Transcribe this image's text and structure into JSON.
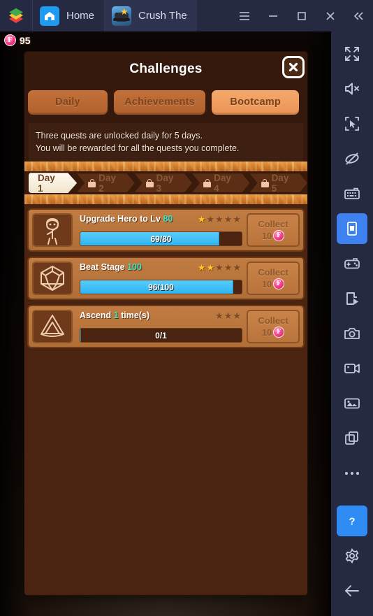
{
  "window": {
    "app_logo": "bluestacks-logo",
    "tabs": [
      {
        "label": "Home",
        "icon": "home-icon",
        "active": false
      },
      {
        "label": "Crush The",
        "icon": "game-app-icon",
        "active": true
      }
    ],
    "controls": [
      {
        "name": "menu-button",
        "icon": "hamburger-icon"
      },
      {
        "name": "minimize-button",
        "icon": "minimize-icon"
      },
      {
        "name": "maximize-button",
        "icon": "maximize-icon"
      },
      {
        "name": "close-button",
        "icon": "close-icon"
      },
      {
        "name": "collapse-sidebar-button",
        "icon": "chevron-double-left-icon"
      }
    ]
  },
  "game": {
    "currency": {
      "icon": "pink-gem-icon",
      "amount": "95"
    },
    "panel": {
      "title": "Challenges",
      "close_icon": "close-x-icon",
      "tabs": [
        {
          "label": "Daily",
          "active": false
        },
        {
          "label": "Achievements",
          "active": false
        },
        {
          "label": "Bootcamp",
          "active": true
        }
      ],
      "info_lines": [
        "Three quests are unlocked daily for 5 days.",
        "You will be rewarded for all the quests you complete."
      ],
      "days": [
        {
          "label": "Day 1",
          "locked": false
        },
        {
          "label": "Day 2",
          "locked": true
        },
        {
          "label": "Day 3",
          "locked": true
        },
        {
          "label": "Day 4",
          "locked": true
        },
        {
          "label": "Day 5",
          "locked": true
        }
      ],
      "quests": [
        {
          "icon": "hero-character-icon",
          "title_prefix": "Upgrade Hero to Lv ",
          "title_value": "80",
          "title_suffix": "",
          "stars_total": 5,
          "stars_filled": 1,
          "progress_text": "69/80",
          "progress_current": 69,
          "progress_max": 80,
          "collect_label": "Collect",
          "reward_amount": "10",
          "reward_icon": "pink-gem-icon",
          "collect_enabled": false
        },
        {
          "icon": "dice-d20-icon",
          "title_prefix": "Beat Stage ",
          "title_value": "100",
          "title_suffix": "",
          "stars_total": 5,
          "stars_filled": 2,
          "progress_text": "96/100",
          "progress_current": 96,
          "progress_max": 100,
          "collect_label": "Collect",
          "reward_amount": "10",
          "reward_icon": "pink-gem-icon",
          "collect_enabled": false
        },
        {
          "icon": "triangle-ascend-icon",
          "title_prefix": "Ascend ",
          "title_value": "1",
          "title_suffix": " time(s)",
          "stars_total": 3,
          "stars_filled": 0,
          "progress_text": "0/1",
          "progress_current": 0,
          "progress_max": 1,
          "collect_label": "Collect",
          "reward_amount": "10",
          "reward_icon": "pink-gem-icon",
          "collect_enabled": false
        }
      ]
    }
  },
  "sidebar": {
    "items": [
      {
        "name": "fullscreen-button",
        "icon": "fullscreen-icon",
        "highlighted": false
      },
      {
        "name": "mute-button",
        "icon": "speaker-mute-icon",
        "highlighted": false
      },
      {
        "name": "click-target-button",
        "icon": "cursor-target-icon",
        "highlighted": false
      },
      {
        "name": "eye-off-button",
        "icon": "eye-off-icon",
        "highlighted": false
      },
      {
        "name": "keyboard-controls-button",
        "icon": "keyboard-icon",
        "highlighted": false
      },
      {
        "name": "rotate-screen-button",
        "icon": "phone-screen-icon",
        "highlighted": true
      },
      {
        "name": "gamepad-button",
        "icon": "gamepad-icon",
        "highlighted": false
      },
      {
        "name": "macro-recorder-button",
        "icon": "script-play-icon",
        "highlighted": false
      },
      {
        "name": "screenshot-button",
        "icon": "camera-icon",
        "highlighted": false
      },
      {
        "name": "record-video-button",
        "icon": "video-camera-icon",
        "highlighted": false
      },
      {
        "name": "media-manager-button",
        "icon": "image-gallery-icon",
        "highlighted": false
      },
      {
        "name": "multi-instance-button",
        "icon": "copy-windows-icon",
        "highlighted": false
      },
      {
        "name": "more-options-button",
        "icon": "ellipsis-icon",
        "highlighted": false
      }
    ],
    "bottom_items": [
      {
        "name": "help-button",
        "icon": "question-mark-icon",
        "highlighted": true
      },
      {
        "name": "settings-button",
        "icon": "gear-icon",
        "highlighted": false
      },
      {
        "name": "back-button",
        "icon": "arrow-left-icon",
        "highlighted": false
      }
    ]
  },
  "colors": {
    "titlebar": "#252a42",
    "accent_blue": "#3d82f0",
    "panel_bg": "#34190c",
    "quest_row": "#c07c42",
    "tab_active": "#f5a86b",
    "progress_fill": "#2eb4f0",
    "gem_pink": "#f5458c",
    "title_highlight": "#3ce4c8",
    "star_gold": "#ffc62e"
  }
}
